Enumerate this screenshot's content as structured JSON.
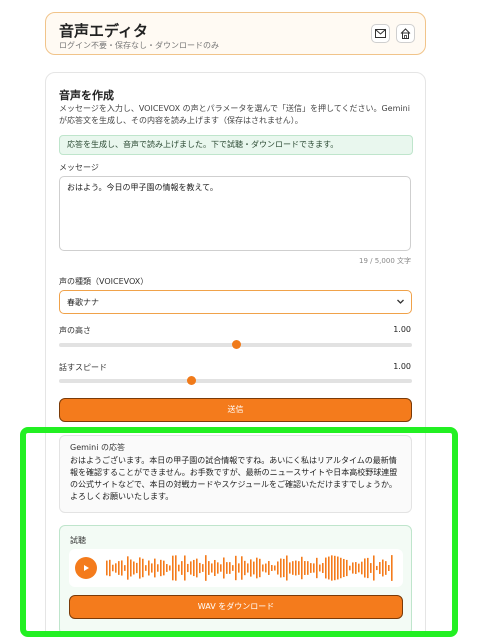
{
  "header": {
    "title": "音声エディタ",
    "subtitle": "ログイン不要・保存なし・ダウンロードのみ",
    "mail_icon": "mail-icon",
    "home_icon": "home-icon"
  },
  "create": {
    "title": "音声を作成",
    "description": "メッセージを入力し、VOICEVOX の声とパラメータを選んで「送信」を押してください。Gemini が応答文を生成し、その内容を読み上げます（保存はされません）。",
    "notice": "応答を生成し、音声で読み上げました。下で試聴・ダウンロードできます。",
    "message_label": "メッセージ",
    "message_value": "おはよう。今日の甲子園の情報を教えて。",
    "counter": "19 / 5,000 文字",
    "voice_label": "声の種類（VOICEVOX）",
    "voice_selected": "春歌ナナ",
    "pitch_label": "声の高さ",
    "pitch_value": "1.00",
    "pitch_level": 0.5,
    "speed_label": "話すスピード",
    "speed_value": "1.00",
    "speed_level": 0.375,
    "send_label": "送信"
  },
  "response": {
    "title": "Gemini の応答",
    "text": "おはようございます。本日の甲子園の試合情報ですね。あいにく私はリアルタイムの最新情報を確認することができません。お手数ですが、最新のニュースサイトや日本高校野球連盟の公式サイトなどで、本日の対戦カードやスケジュールをご確認いただけますでしょうか。よろしくお願いいたします。"
  },
  "trial": {
    "title": "試聴",
    "download_label": "WAV をダウンロード"
  },
  "colors": {
    "accent": "#f47b1c",
    "highlight": "#22f022"
  }
}
